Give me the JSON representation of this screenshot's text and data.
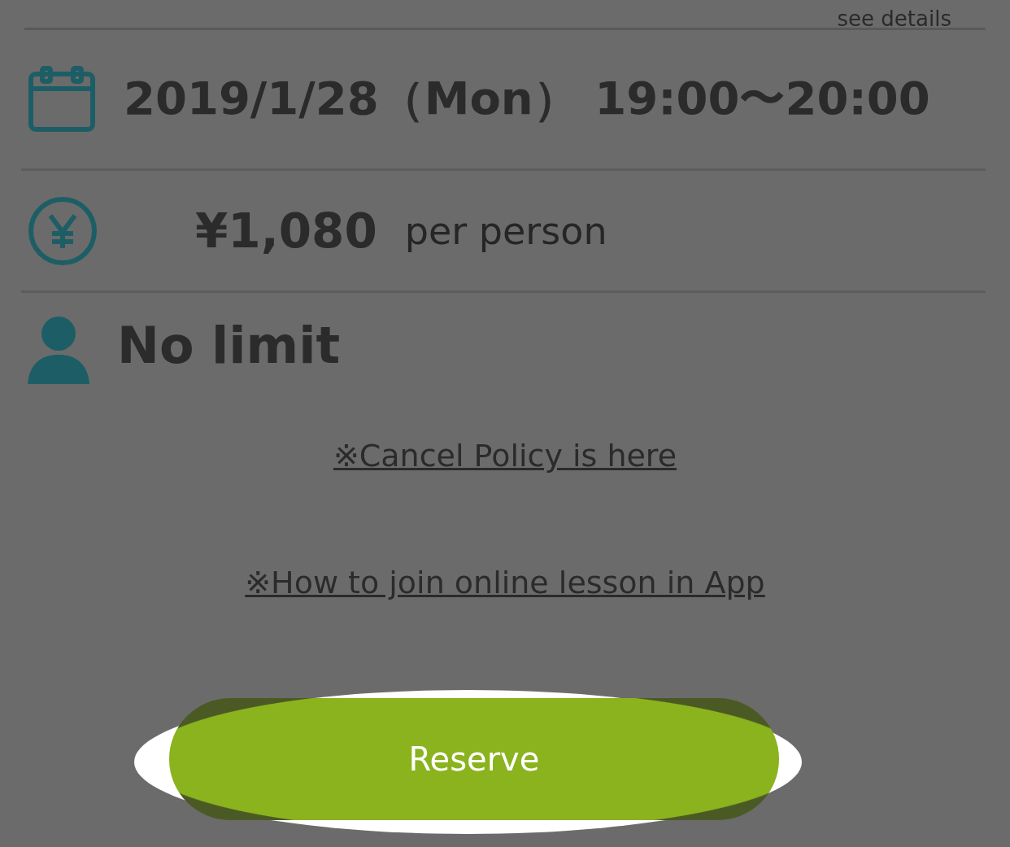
{
  "header_link": "see details",
  "details": [
    {
      "kind": "date",
      "text": "2019/1/28（Mon） 19:00〜20:00"
    },
    {
      "kind": "price",
      "text": "¥1,080",
      "suffix": "per person"
    },
    {
      "kind": "capacity",
      "text": "No limit"
    }
  ],
  "links": [
    "※Cancel Policy is here",
    "※How to join online lesson in App"
  ],
  "reserve_button": {
    "label": "Reserve",
    "highlighted": true
  }
}
